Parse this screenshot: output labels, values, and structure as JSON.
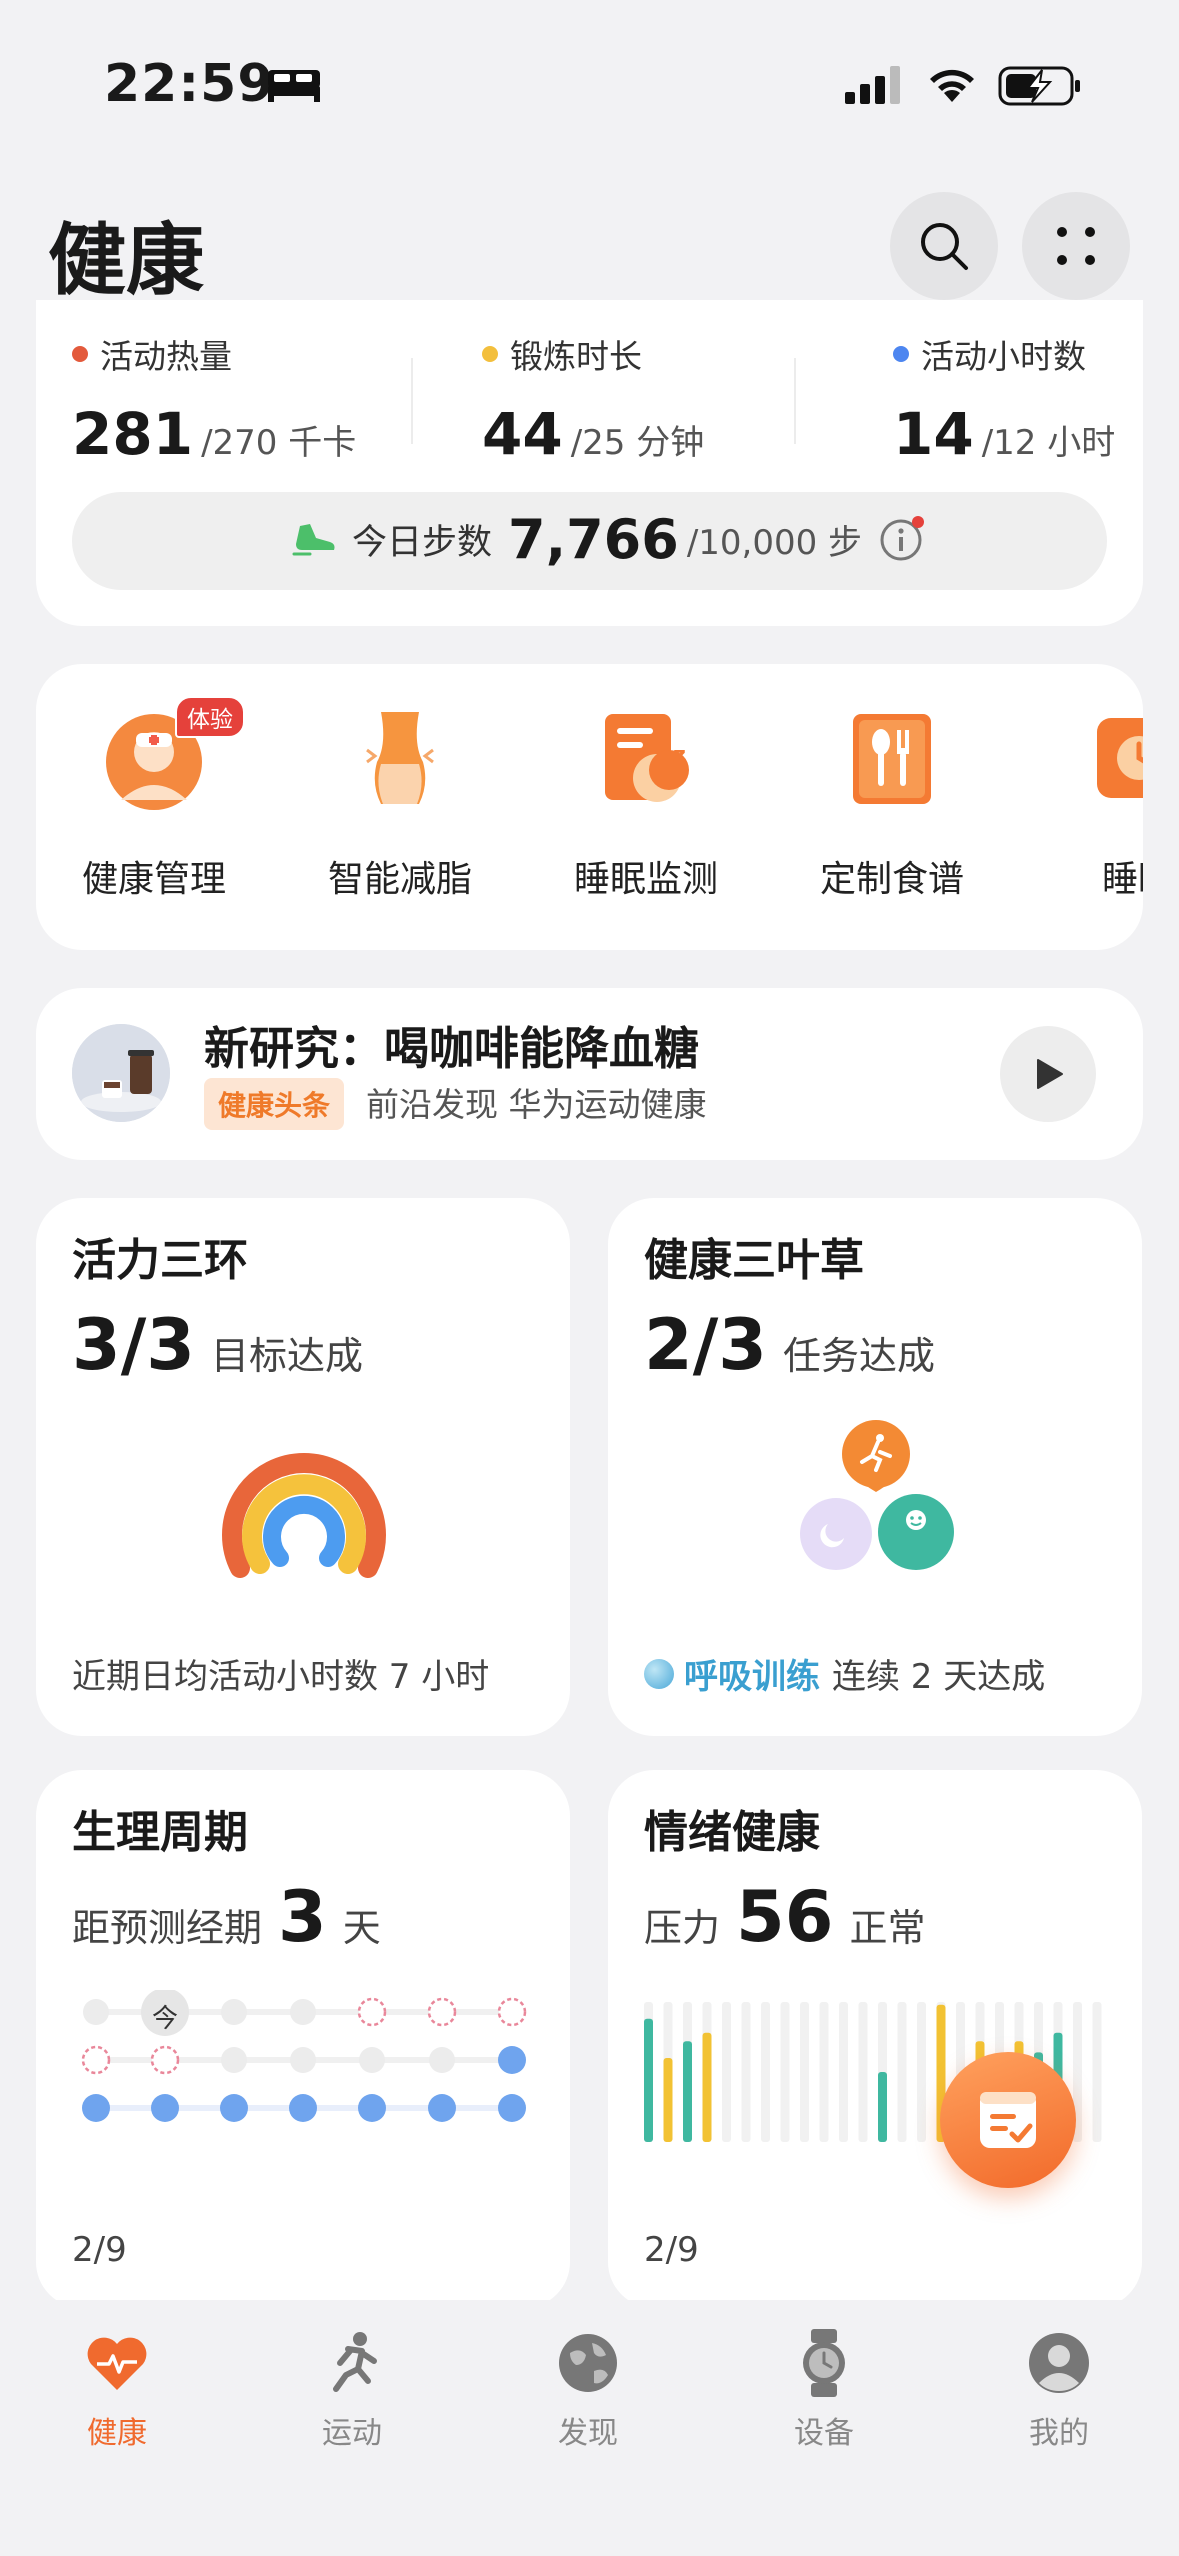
{
  "status_bar": {
    "time": "22:59"
  },
  "header": {
    "title": "健康"
  },
  "activity": {
    "items": [
      {
        "label": "活动热量",
        "value": "281",
        "goal": "/270 千卡",
        "color": "#e35a3c"
      },
      {
        "label": "锻炼时长",
        "value": "44",
        "goal": "/25 分钟",
        "color": "#f3bf3d"
      },
      {
        "label": "活动小时数",
        "value": "14",
        "goal": "/12 小时",
        "color": "#4d86f0"
      }
    ],
    "steps": {
      "label": "今日步数",
      "value": "7,766",
      "goal": "/10,000 步"
    }
  },
  "services": [
    {
      "label": "健康管理",
      "badge": "体验",
      "icon": "health-management-icon"
    },
    {
      "label": "智能减脂",
      "icon": "fat-loss-icon"
    },
    {
      "label": "睡眠监测",
      "icon": "sleep-monitor-icon"
    },
    {
      "label": "定制食谱",
      "icon": "recipe-icon"
    },
    {
      "label": "睡眠",
      "icon": "sleep-icon"
    }
  ],
  "news": {
    "headline": "新研究：喝咖啡能降血糖",
    "tag": "健康头条",
    "source": "前沿发现 华为运动健康"
  },
  "rings_card": {
    "title": "活力三环",
    "value": "3/3",
    "suffix": "目标达成",
    "footer": "近期日均活动小时数 7 小时"
  },
  "clover_card": {
    "title": "健康三叶草",
    "value": "2/3",
    "suffix": "任务达成",
    "footer_link": "呼吸训练",
    "footer_rest": "连续 2 天达成"
  },
  "cycle_card": {
    "title": "生理周期",
    "prefix": "距预测经期",
    "value": "3",
    "suffix": "天",
    "today": "今",
    "footer": "2/9"
  },
  "mood_card": {
    "title": "情绪健康",
    "prefix": "压力",
    "value": "56",
    "suffix": "正常",
    "footer": "2/9"
  },
  "bottom_nav": [
    {
      "label": "健康",
      "active": true
    },
    {
      "label": "运动"
    },
    {
      "label": "发现"
    },
    {
      "label": "设备"
    },
    {
      "label": "我的"
    }
  ],
  "colors": {
    "accent": "#f06a2e",
    "teal": "#3fb8a0",
    "yellow": "#f2c233",
    "blue": "#4d86f0"
  }
}
